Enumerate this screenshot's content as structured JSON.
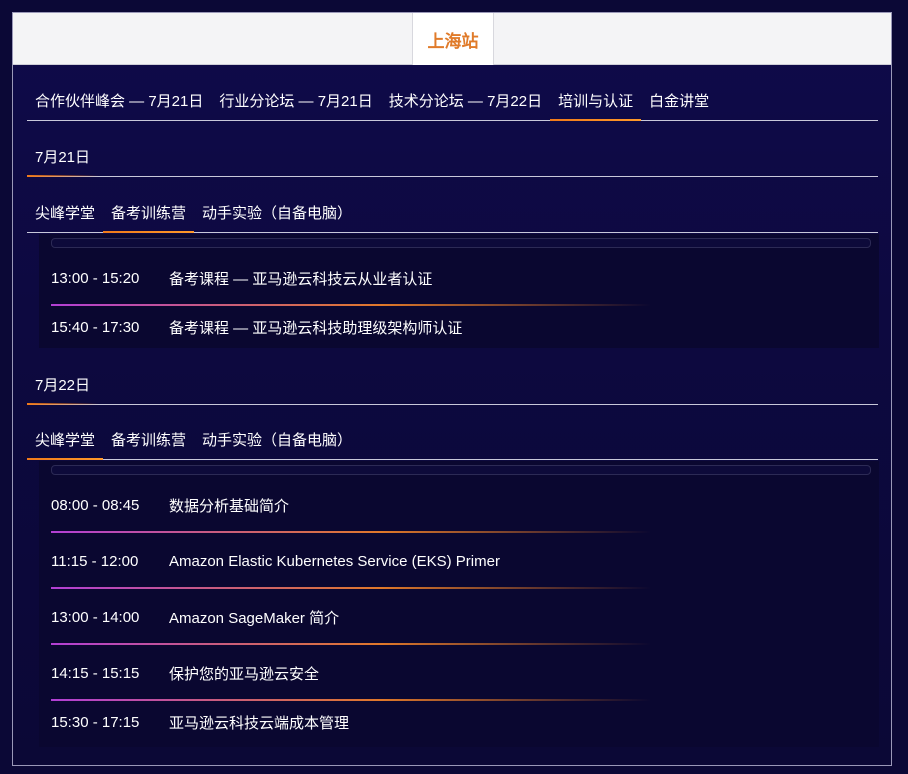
{
  "city": {
    "label": "上海站"
  },
  "forums": [
    {
      "label": "合作伙伴峰会 — 7月21日",
      "active": false
    },
    {
      "label": "行业分论坛 — 7月21日",
      "active": false
    },
    {
      "label": "技术分论坛 — 7月22日",
      "active": false
    },
    {
      "label": "培训与认证",
      "active": true
    },
    {
      "label": "白金讲堂",
      "active": false
    }
  ],
  "day1": {
    "date": "7月21日",
    "tracks": [
      {
        "label": "尖峰学堂",
        "active": false
      },
      {
        "label": "备考训练营",
        "active": true
      },
      {
        "label": "动手实验（自备电脑）",
        "active": false
      }
    ],
    "sessions": [
      {
        "time": "13:00 - 15:20",
        "title": "备考课程 — 亚马逊云科技云从业者认证"
      },
      {
        "time": "15:40 - 17:30",
        "title": "备考课程 — 亚马逊云科技助理级架构师认证"
      }
    ]
  },
  "day2": {
    "date": "7月22日",
    "tracks": [
      {
        "label": "尖峰学堂",
        "active": true
      },
      {
        "label": "备考训练营",
        "active": false
      },
      {
        "label": "动手实验（自备电脑）",
        "active": false
      }
    ],
    "sessions": [
      {
        "time": "08:00 - 08:45",
        "title": "数据分析基础简介"
      },
      {
        "time": "11:15 - 12:00",
        "title": "Amazon Elastic Kubernetes Service (EKS) Primer"
      },
      {
        "time": "13:00 - 14:00",
        "title": "Amazon SageMaker 简介"
      },
      {
        "time": "14:15 - 15:15",
        "title": "保护您的亚马逊云安全"
      },
      {
        "time": "15:30 - 17:15",
        "title": "亚马逊云科技云端成本管理"
      }
    ]
  },
  "colors": {
    "accent": "#e07b2a",
    "background": "#0b0836",
    "separator_start": "#b23fd6"
  }
}
